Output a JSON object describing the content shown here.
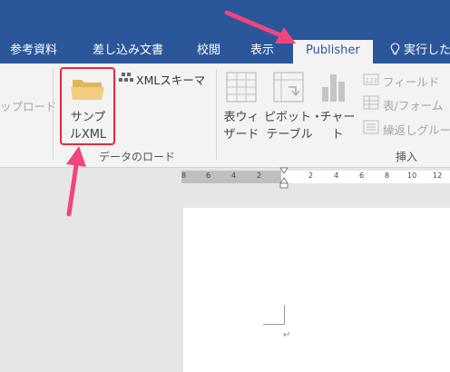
{
  "tabs": [
    {
      "label": "参考資料"
    },
    {
      "label": "差し込み文書"
    },
    {
      "label": "校閲"
    },
    {
      "label": "表示"
    },
    {
      "label": "Publisher"
    }
  ],
  "tell_me": "実行した",
  "ribbon": {
    "left_cut_label": "ップロード",
    "sample_button": {
      "line1": "サンプ",
      "line2": "ルXML"
    },
    "xml_schema": "XMLスキーマ",
    "data_group_label": "データのロード",
    "wizard_button": {
      "line1": "表ウィ",
      "line2": "ザード"
    },
    "pivot_button": {
      "line1": "ピボット・",
      "line2": "テーブル"
    },
    "chart_button": {
      "line1": "チャー",
      "line2": "ト"
    },
    "field": "フィールド",
    "table_form": "表/フォーム",
    "repeat_group": "繰返しグルー",
    "insert_group_label": "挿入"
  },
  "ruler_numbers": [
    "8",
    "6",
    "4",
    "2",
    "2",
    "4",
    "6",
    "8",
    "10",
    "12"
  ],
  "paragraph_mark": "↵",
  "colors": {
    "accent": "#2b579a",
    "highlight_red": "#e8283c",
    "arrow_pink": "#f0457d"
  }
}
